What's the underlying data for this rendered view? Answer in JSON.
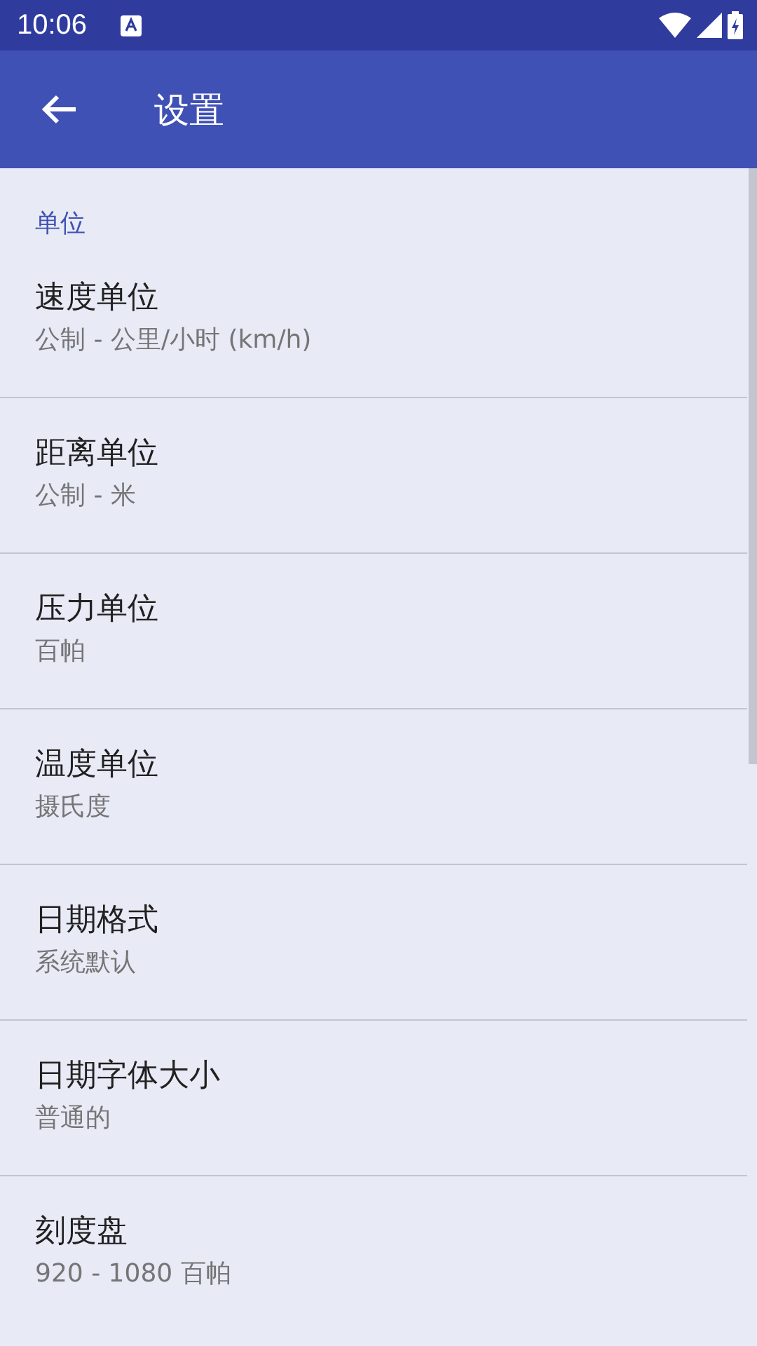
{
  "status_bar": {
    "time": "10:06"
  },
  "app_bar": {
    "title": "设置"
  },
  "section": {
    "title": "单位"
  },
  "settings": [
    {
      "title": "速度单位",
      "value": "公制 - 公里/小时 (km/h)"
    },
    {
      "title": "距离单位",
      "value": "公制 - 米"
    },
    {
      "title": "压力单位",
      "value": "百帕"
    },
    {
      "title": "温度单位",
      "value": "摄氏度"
    },
    {
      "title": "日期格式",
      "value": "系统默认"
    },
    {
      "title": "日期字体大小",
      "value": "普通的"
    },
    {
      "title": "刻度盘",
      "value": "920 - 1080 百帕"
    }
  ]
}
